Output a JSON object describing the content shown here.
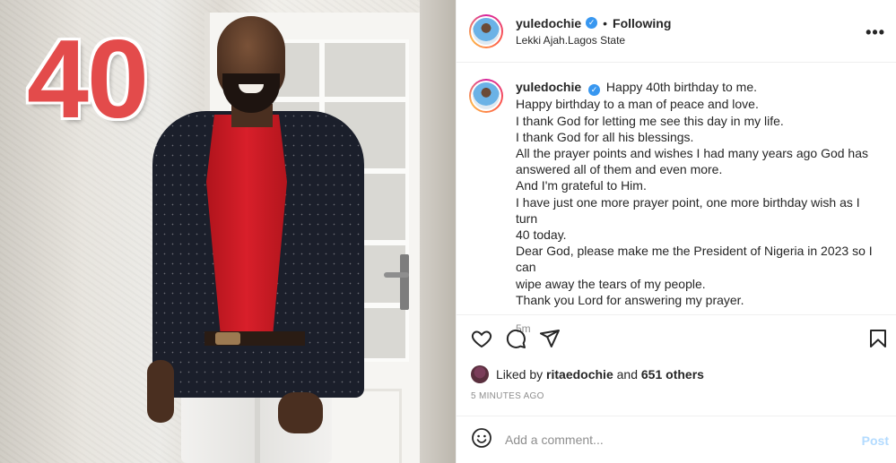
{
  "photo": {
    "overlay_number": "40"
  },
  "header": {
    "username": "yuledochie",
    "separator": "•",
    "follow_status": "Following",
    "location": "Lekki Ajah.Lagos State",
    "more_glyph": "•••"
  },
  "caption": {
    "username": "yuledochie",
    "lines": [
      "Happy 40th birthday to me.",
      "Happy birthday to a man of peace and love.",
      "I thank God for letting me see this day in my life.",
      "I thank God for all his blessings.",
      "All the prayer points and wishes I had many years ago God has",
      "answered all of them and even more.",
      "And I'm grateful to Him.",
      "I have just one more prayer point, one more birthday wish as I turn",
      "40 today.",
      "Dear God, please make me the President of Nigeria in 2023 so I can",
      "wipe away the tears of my people.",
      "Thank you Lord for answering my prayer."
    ],
    "time_ago": "5m"
  },
  "actions": {
    "icons": [
      "heart-icon",
      "comment-icon",
      "share-icon",
      "bookmark-icon"
    ]
  },
  "likes": {
    "prefix": "Liked by",
    "user": "ritaedochie",
    "conjunction": "and",
    "others": "651 others"
  },
  "posted": "5 MINUTES AGO",
  "comment": {
    "placeholder": "Add a comment...",
    "post_label": "Post"
  },
  "colors": {
    "link_blue": "#3897f0",
    "post_disabled": "#b3dbff",
    "overlay_red": "#e34b4b"
  }
}
